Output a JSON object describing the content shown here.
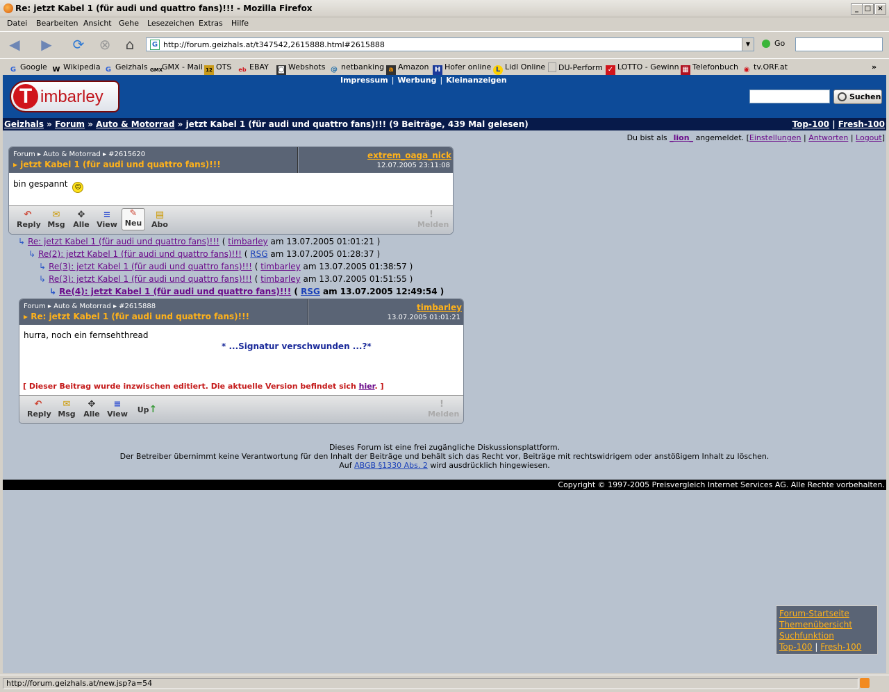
{
  "window": {
    "title": "Re: jetzt Kabel 1 (für audi und quattro fans)!!! - Mozilla Firefox"
  },
  "menu": [
    "Datei",
    "Bearbeiten",
    "Ansicht",
    "Gehe",
    "Lesezeichen",
    "Extras",
    "Hilfe"
  ],
  "nav": {
    "url": "http://forum.geizhals.at/t347542,2615888.html#2615888",
    "go_label": "Go"
  },
  "bookmarks": [
    "Google",
    "Wikipedia",
    "Geizhals",
    "GMX - Mail",
    "OTS",
    "EBAY",
    "Webshots",
    "netbanking",
    "Amazon",
    "Hofer online",
    "Lidl Online",
    "DU-Perform",
    "LOTTO - Gewinn",
    "Telefonbuch",
    "tv.ORF.at"
  ],
  "site": {
    "logo_letter": "T",
    "logo_text": "imbarley",
    "toplinks": [
      "Impressum",
      "Werbung",
      "Kleinanzeigen"
    ],
    "search_button": "Suchen"
  },
  "breadcrumb": {
    "items": [
      "Geizhals",
      "Forum",
      "Auto & Motorrad"
    ],
    "current": "» jetzt Kabel 1 (für audi und quattro fans)!!! (9 Beiträge, 439 Mal gelesen)",
    "right": [
      "Top-100",
      "Fresh-100"
    ]
  },
  "userline": {
    "prefix": "Du bist als",
    "user": "_lion_",
    "suffix": "angemeldet. [",
    "links": [
      "Einstellungen",
      "Antworten",
      "Logout"
    ]
  },
  "post1": {
    "crumb": "Forum ▸ Auto & Motorrad ▸ #2615620",
    "title": "jetzt Kabel 1 (für audi und quattro fans)!!!",
    "author": "extrem_oaga_nick",
    "date": "12.07.2005 23:11:08",
    "body": "bin gespannt",
    "buttons": [
      "Reply",
      "Msg",
      "Alle",
      "View",
      "Neu",
      "Abo"
    ],
    "report": "Melden"
  },
  "thread": [
    {
      "title": "Re: jetzt Kabel 1 (für audi und quattro fans)!!!",
      "user": "timbarley",
      "date": "am 13.07.2005 01:01:21"
    },
    {
      "title": "Re(2): jetzt Kabel 1 (für audi und quattro fans)!!!",
      "user": "RSG",
      "date": "am 13.07.2005 01:28:37"
    },
    {
      "title": "Re(3): jetzt Kabel 1 (für audi und quattro fans)!!!",
      "user": "timbarley",
      "date": "am 13.07.2005 01:38:57"
    },
    {
      "title": "Re(3): jetzt Kabel 1 (für audi und quattro fans)!!!",
      "user": "timbarley",
      "date": "am 13.07.2005 01:51:55"
    },
    {
      "title": "Re(4): jetzt Kabel 1 (für audi und quattro fans)!!!",
      "user": "RSG",
      "date": "am 13.07.2005 12:49:54"
    }
  ],
  "post2": {
    "crumb": "Forum ▸ Auto & Motorrad ▸ #2615888",
    "title": "Re: jetzt Kabel 1 (für audi und quattro fans)!!!",
    "author": "timbarley",
    "date": "13.07.2005 01:01:21",
    "body": "hurra, noch ein fernsehthread",
    "signature": "* ...Signatur verschwunden ...?*",
    "edit_prefix": "[ Dieser Beitrag wurde inzwischen editiert. Die aktuelle Version befindet sich ",
    "edit_link": "hier",
    "edit_suffix": ". ]",
    "buttons": [
      "Reply",
      "Msg",
      "Alle",
      "View",
      "Up"
    ],
    "report": "Melden"
  },
  "footer": {
    "line1": "Dieses Forum ist eine frei zugängliche Diskussionsplattform.",
    "line2": "Der Betreiber übernimmt keine Verantwortung für den Inhalt der Beiträge und behält sich das Recht vor, Beiträge mit rechtswidrigem oder anstößigem Inhalt zu löschen.",
    "line3_prefix": "Auf",
    "line3_link": "ABGB §1330 Abs. 2",
    "line3_suffix": "wird ausdrücklich hingewiesen.",
    "copyright": "Copyright © 1997-2005 Preisvergleich Internet Services AG. Alle Rechte vorbehalten."
  },
  "navbox": [
    "Forum-Startseite",
    "Themenübersicht",
    "Suchfunktion",
    "Top-100",
    "Fresh-100"
  ],
  "status": {
    "text": "http://forum.geizhals.at/new.jsp?a=54"
  }
}
